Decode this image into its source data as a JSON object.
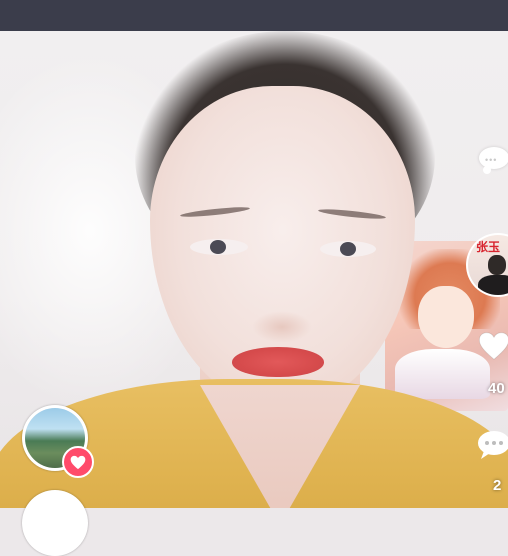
{
  "video": {
    "avatar_badge_text": "张玉"
  },
  "side_actions": {
    "like_count": "40",
    "comment_count": "2"
  },
  "colors": {
    "status_bar": "#3b3d4b",
    "like_badge": "#ff4b6a",
    "shirt": "#dfb24f"
  },
  "icons": {
    "top_bubble": "chat-bubble-icon",
    "like": "heart-icon",
    "comment": "comment-icon",
    "thumb_badge": "heart-badge-icon"
  }
}
